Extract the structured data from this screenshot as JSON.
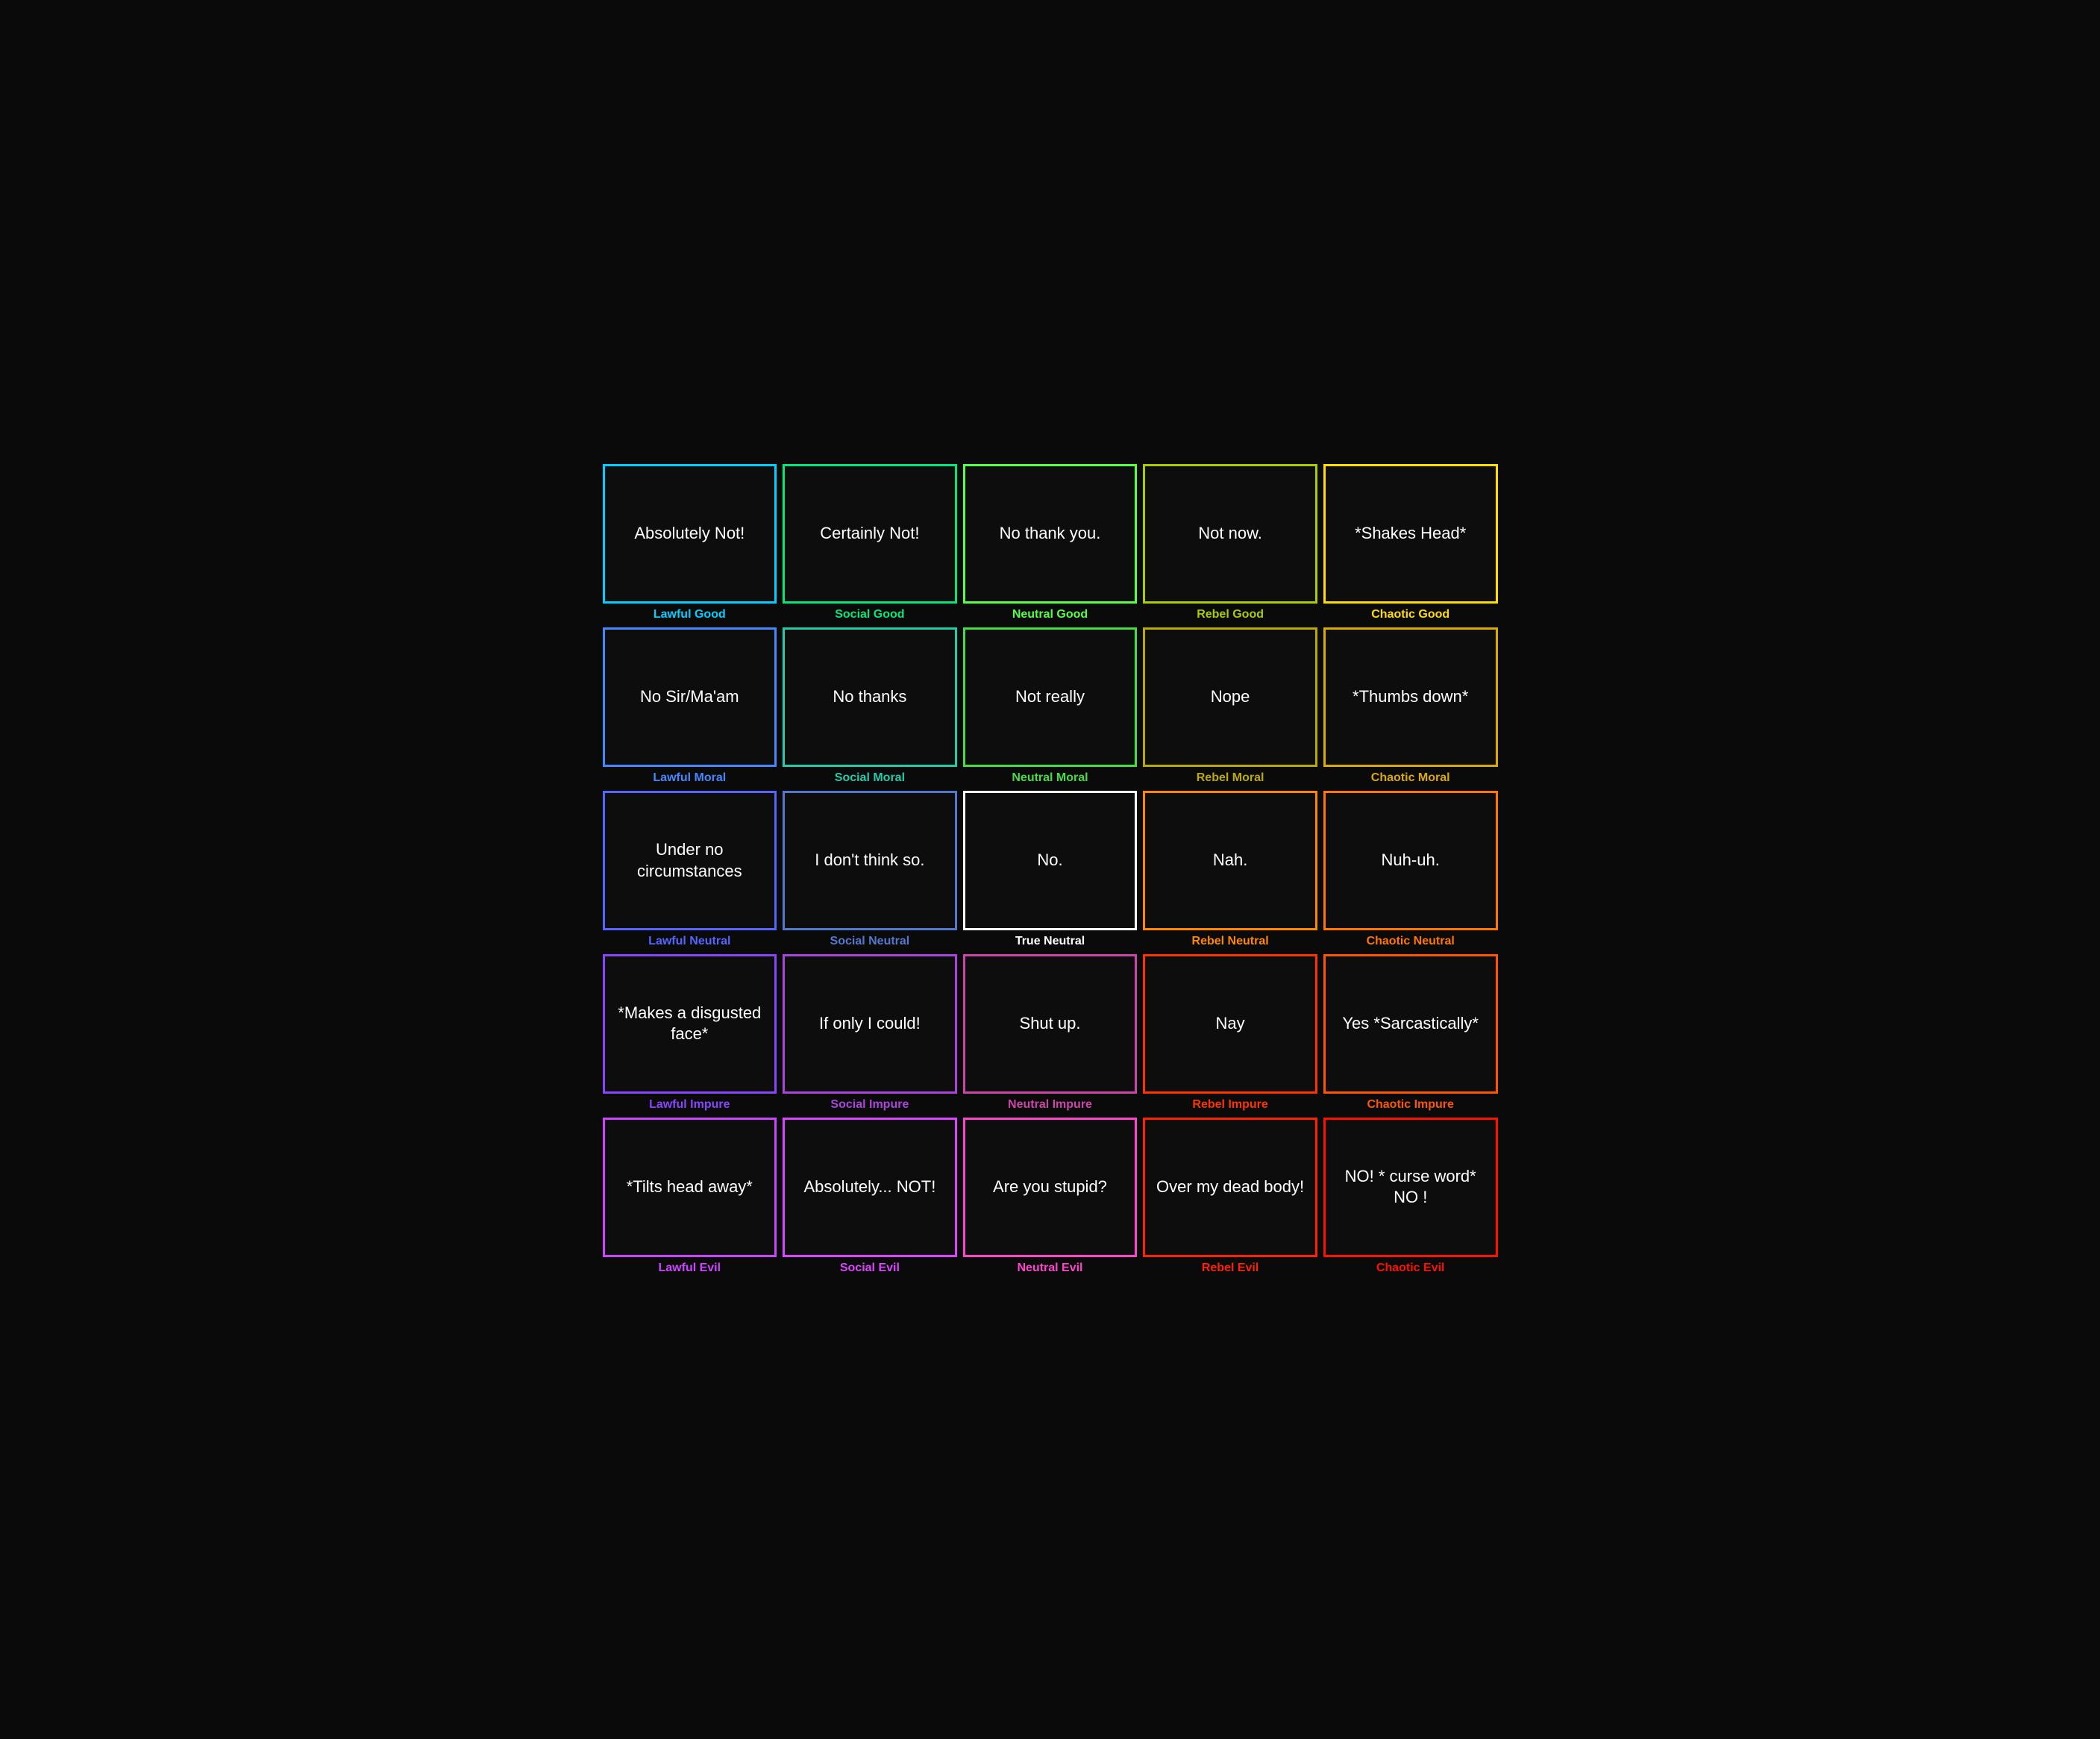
{
  "grid": [
    [
      {
        "text": "Absolutely Not!",
        "label": "Lawful Good",
        "row": 1,
        "col": 1
      },
      {
        "text": "Certainly Not!",
        "label": "Social Good",
        "row": 1,
        "col": 2
      },
      {
        "text": "No thank you.",
        "label": "Neutral Good",
        "row": 1,
        "col": 3
      },
      {
        "text": "Not now.",
        "label": "Rebel Good",
        "row": 1,
        "col": 4
      },
      {
        "text": "*Shakes Head*",
        "label": "Chaotic Good",
        "row": 1,
        "col": 5
      }
    ],
    [
      {
        "text": "No Sir/Ma'am",
        "label": "Lawful Moral",
        "row": 2,
        "col": 1
      },
      {
        "text": "No thanks",
        "label": "Social Moral",
        "row": 2,
        "col": 2
      },
      {
        "text": "Not really",
        "label": "Neutral Moral",
        "row": 2,
        "col": 3
      },
      {
        "text": "Nope",
        "label": "Rebel Moral",
        "row": 2,
        "col": 4
      },
      {
        "text": "*Thumbs down*",
        "label": "Chaotic Moral",
        "row": 2,
        "col": 5
      }
    ],
    [
      {
        "text": "Under no circumstances",
        "label": "Lawful Neutral",
        "row": 3,
        "col": 1
      },
      {
        "text": "I don't think so.",
        "label": "Social Neutral",
        "row": 3,
        "col": 2
      },
      {
        "text": "No.",
        "label": "True Neutral",
        "row": 3,
        "col": 3
      },
      {
        "text": "Nah.",
        "label": "Rebel Neutral",
        "row": 3,
        "col": 4
      },
      {
        "text": "Nuh-uh.",
        "label": "Chaotic Neutral",
        "row": 3,
        "col": 5
      }
    ],
    [
      {
        "text": "*Makes a disgusted face*",
        "label": "Lawful Impure",
        "row": 4,
        "col": 1
      },
      {
        "text": "If only I could!",
        "label": "Social Impure",
        "row": 4,
        "col": 2
      },
      {
        "text": "Shut up.",
        "label": "Neutral Impure",
        "row": 4,
        "col": 3
      },
      {
        "text": "Nay",
        "label": "Rebel Impure",
        "row": 4,
        "col": 4
      },
      {
        "text": "Yes *Sarcastically*",
        "label": "Chaotic Impure",
        "row": 4,
        "col": 5
      }
    ],
    [
      {
        "text": "*Tilts head away*",
        "label": "Lawful Evil",
        "row": 5,
        "col": 1
      },
      {
        "text": "Absolutely... NOT!",
        "label": "Social Evil",
        "row": 5,
        "col": 2
      },
      {
        "text": "Are you stupid?",
        "label": "Neutral Evil",
        "row": 5,
        "col": 3
      },
      {
        "text": "Over my dead body!",
        "label": "Rebel Evil",
        "row": 5,
        "col": 4
      },
      {
        "text": "NO! * curse word* NO !",
        "label": "Chaotic Evil",
        "row": 5,
        "col": 5
      }
    ]
  ]
}
